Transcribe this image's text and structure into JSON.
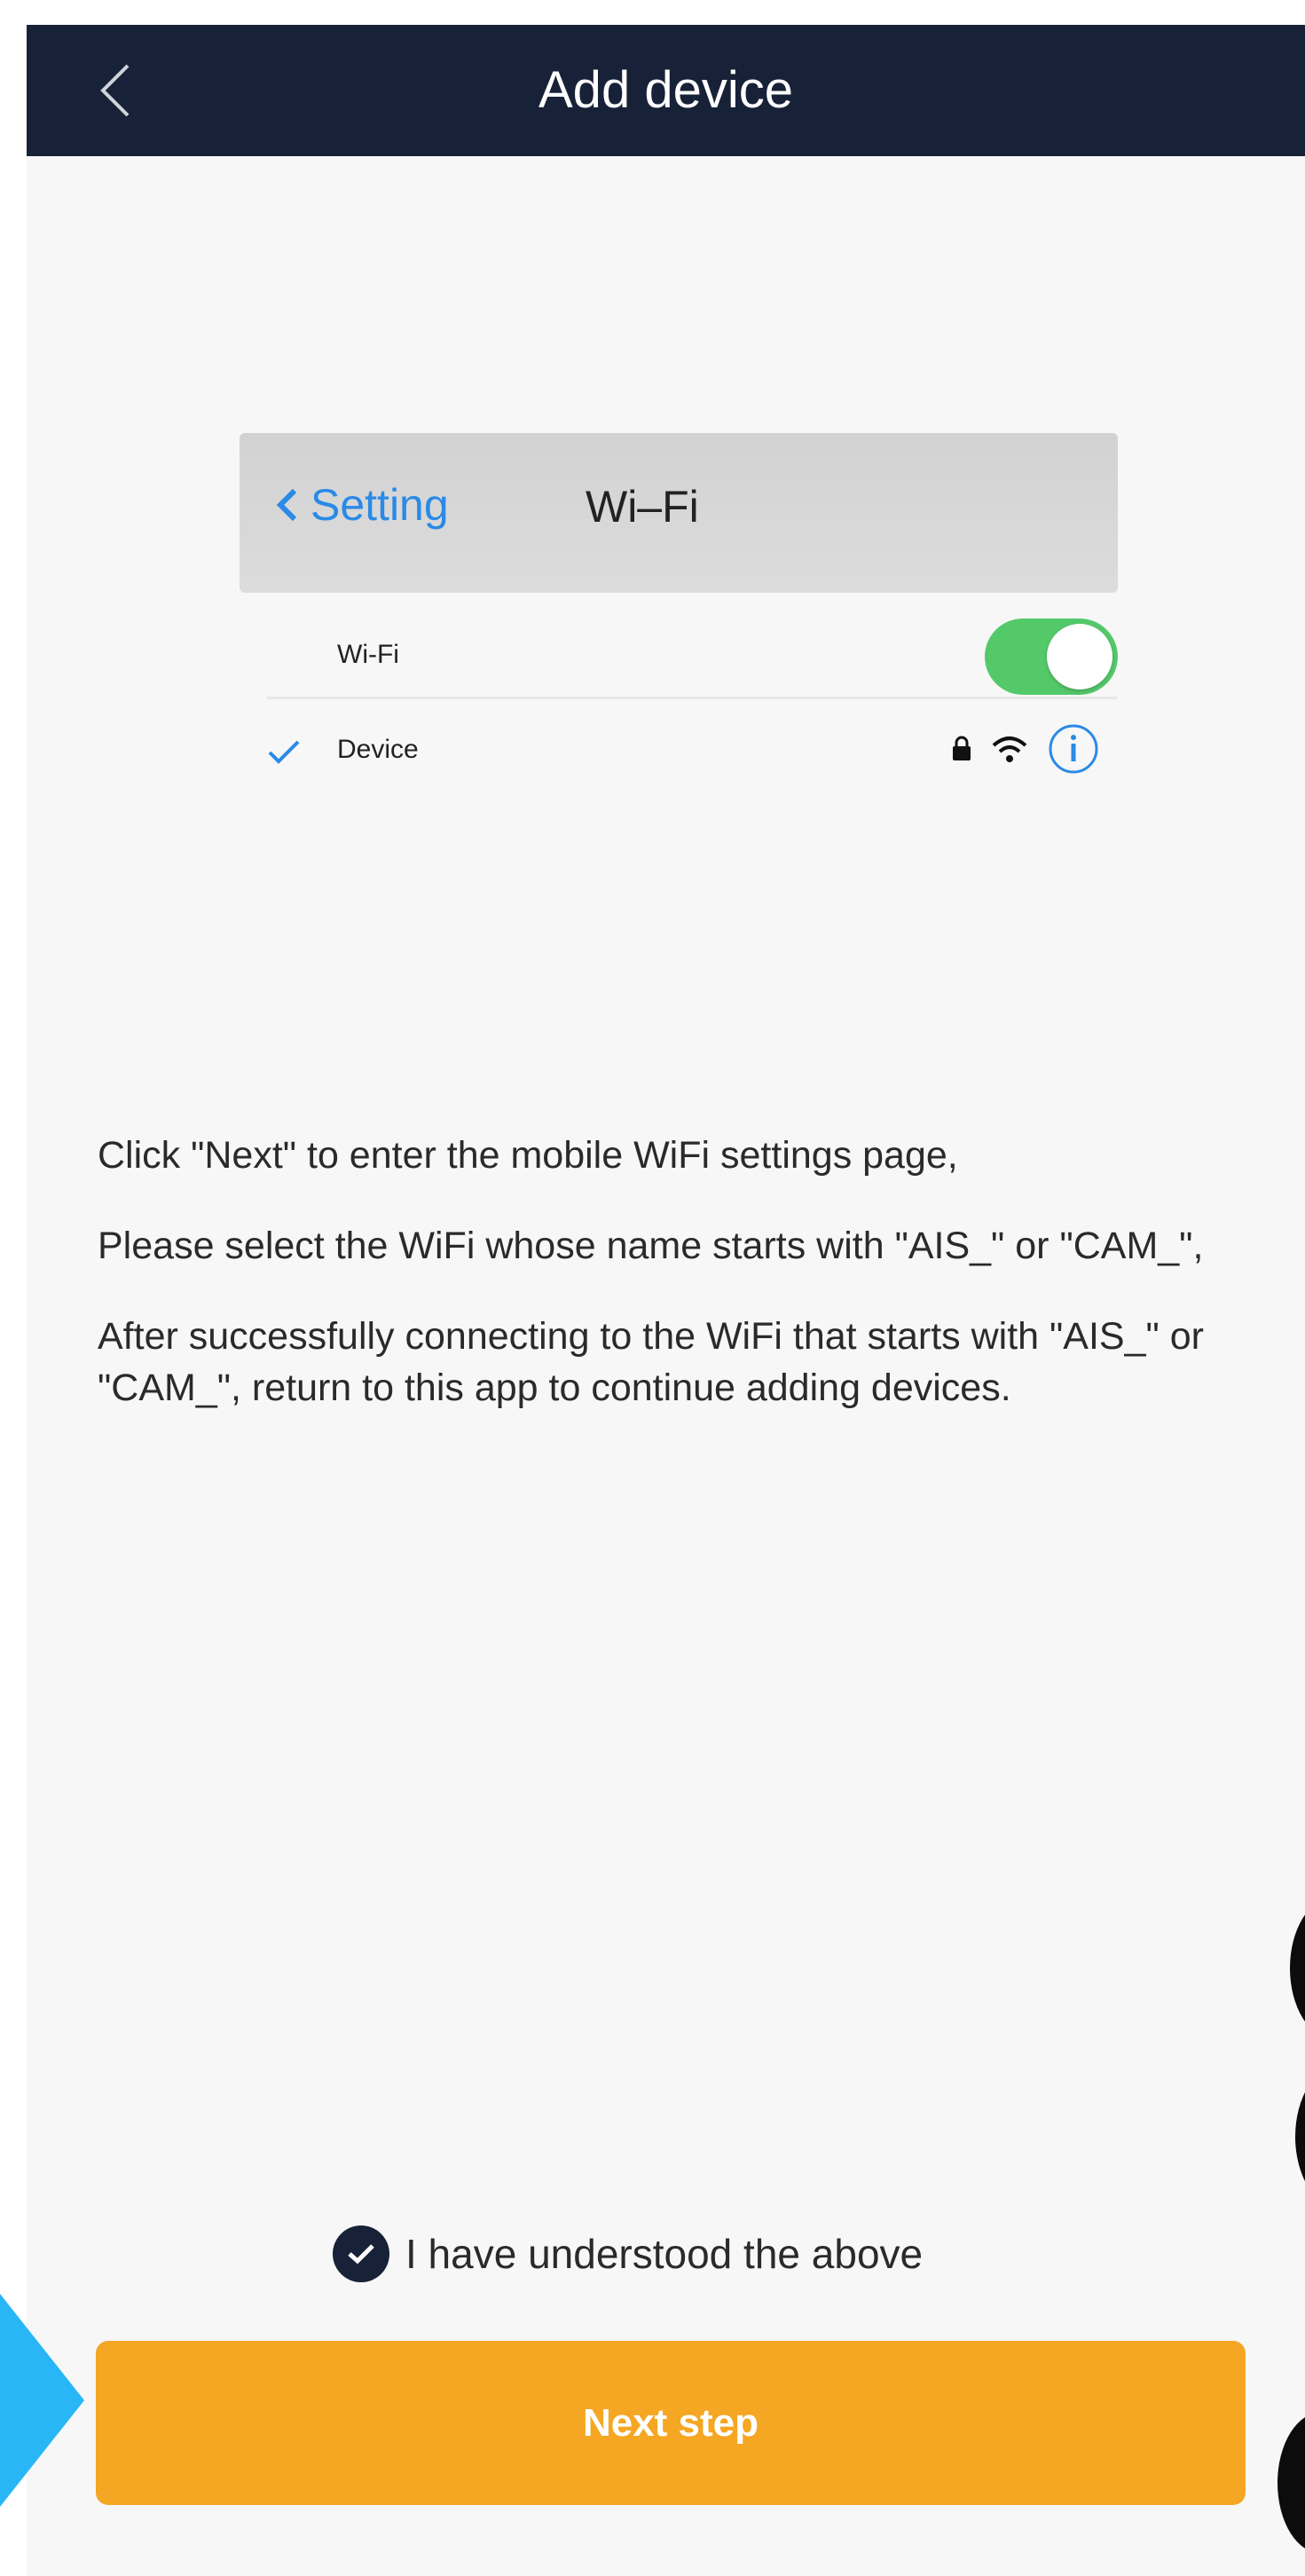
{
  "header": {
    "title": "Add device",
    "back_icon": "chevron-left-icon"
  },
  "illustration": {
    "nav_back_label": "Setting",
    "nav_title": "Wi–Fi",
    "wifi_row_label": "Wi-Fi",
    "wifi_toggle_on": true,
    "device_row_label": "Device",
    "device_icons": [
      "lock-icon",
      "wifi-signal-icon",
      "info-icon"
    ],
    "accent_color": "#2a8ae6",
    "toggle_color": "#54c96a"
  },
  "instructions": {
    "line1": "Click \"Next\" to enter the mobile WiFi settings page,",
    "line2": "Please select the WiFi whose name starts with \"AIS_\" or \"CAM_\",",
    "line3": "After successfully connecting to the WiFi that starts with \"AIS_\" or \"CAM_\", return to this app to continue adding devices."
  },
  "agreement": {
    "checked": true,
    "label": "I have understood the above"
  },
  "next_button": {
    "label": "Next step",
    "color": "#f5a623"
  },
  "theme": {
    "header_bg": "#172238",
    "page_bg": "#f7f7f7"
  }
}
